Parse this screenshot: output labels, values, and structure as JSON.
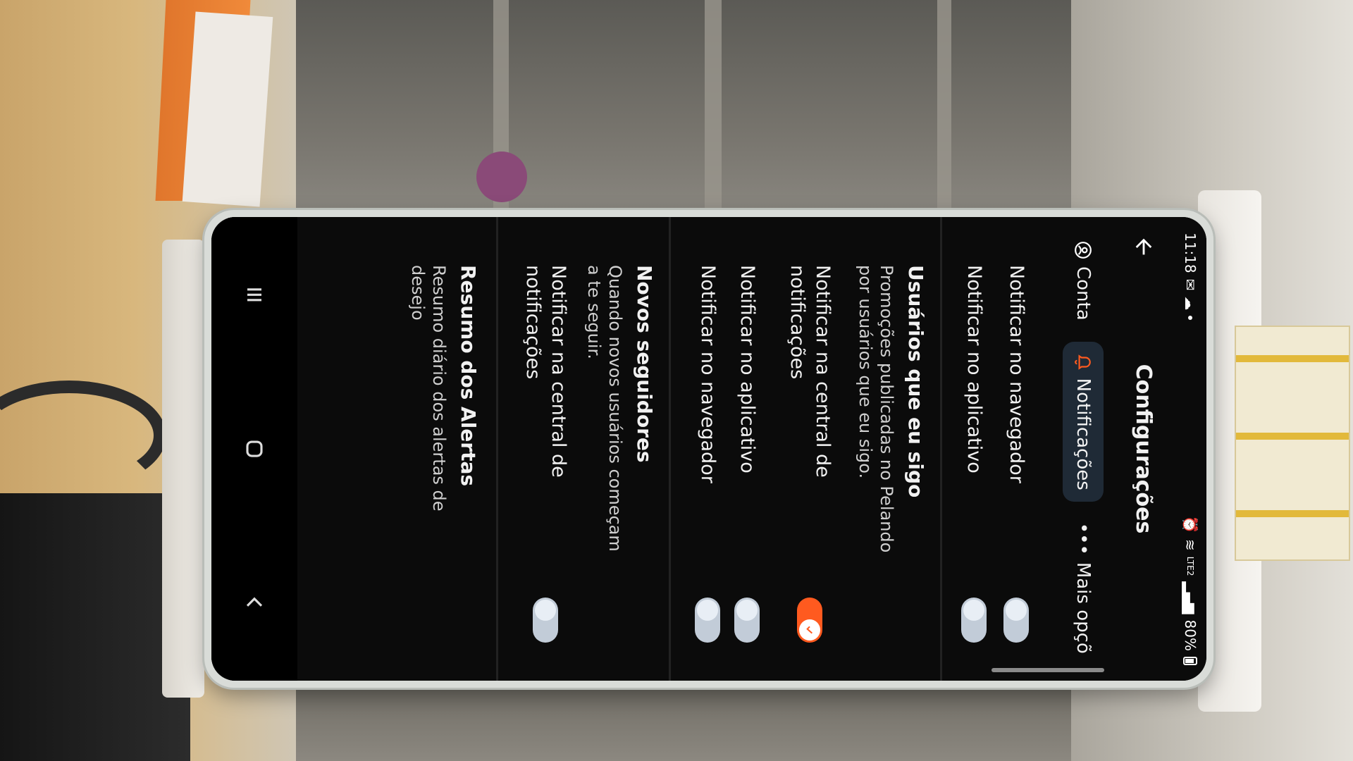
{
  "status": {
    "time": "11:18",
    "battery": "80%",
    "network": "LTE2"
  },
  "header": {
    "title": "Configurações"
  },
  "tabs": [
    {
      "label": "Conta",
      "icon": "account-icon"
    },
    {
      "label": "Notificações",
      "icon": "bell-icon",
      "active": true
    },
    {
      "label": "Mais opçõ",
      "icon": "more-icon"
    }
  ],
  "settings": {
    "general": [
      {
        "label": "Notificar no navegador",
        "on": false
      },
      {
        "label": "Notificar no aplicativo",
        "on": false
      }
    ],
    "followed_users": {
      "title": "Usuários que eu sigo",
      "description": "Promoções publicadas no Pelando por usuários que eu sigo.",
      "items": [
        {
          "label": "Notificar na central de notificações",
          "on": true
        },
        {
          "label": "Notificar no aplicativo",
          "on": false
        },
        {
          "label": "Notificar no navegador",
          "on": false
        }
      ]
    },
    "new_followers": {
      "title": "Novos seguidores",
      "description": "Quando novos usuários começam a te seguir.",
      "items": [
        {
          "label": "Notificar na central de notificações",
          "on": false
        }
      ]
    },
    "alerts_summary": {
      "title": "Resumo dos Alertas",
      "description": "Resumo diário dos alertas de desejo"
    }
  },
  "colors": {
    "accent": "#ff5a1f",
    "toggle_off": "#c2ccd8",
    "background": "#0b0b0b"
  }
}
